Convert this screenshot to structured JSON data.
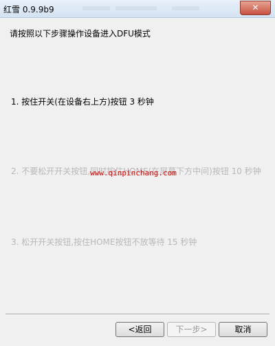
{
  "window": {
    "title": "红雪 0.9.9b9",
    "close_label": "✕"
  },
  "instructions": {
    "heading": "请按照以下步骤操作设备进入DFU模式",
    "step1": "1. 按住开关(在设备右上方)按钮 3 秒钟",
    "step2": "2. 不要松开开关按钮,同时按住HOME(在屏幕下方中间)按钮 10 秒钟",
    "step3": "3. 松开开关按钮,按住HOME按钮不放等待 15 秒钟"
  },
  "watermark": "www.qinpinchang.com",
  "buttons": {
    "back": "<返回",
    "next": "下一步>",
    "cancel": "取消"
  }
}
